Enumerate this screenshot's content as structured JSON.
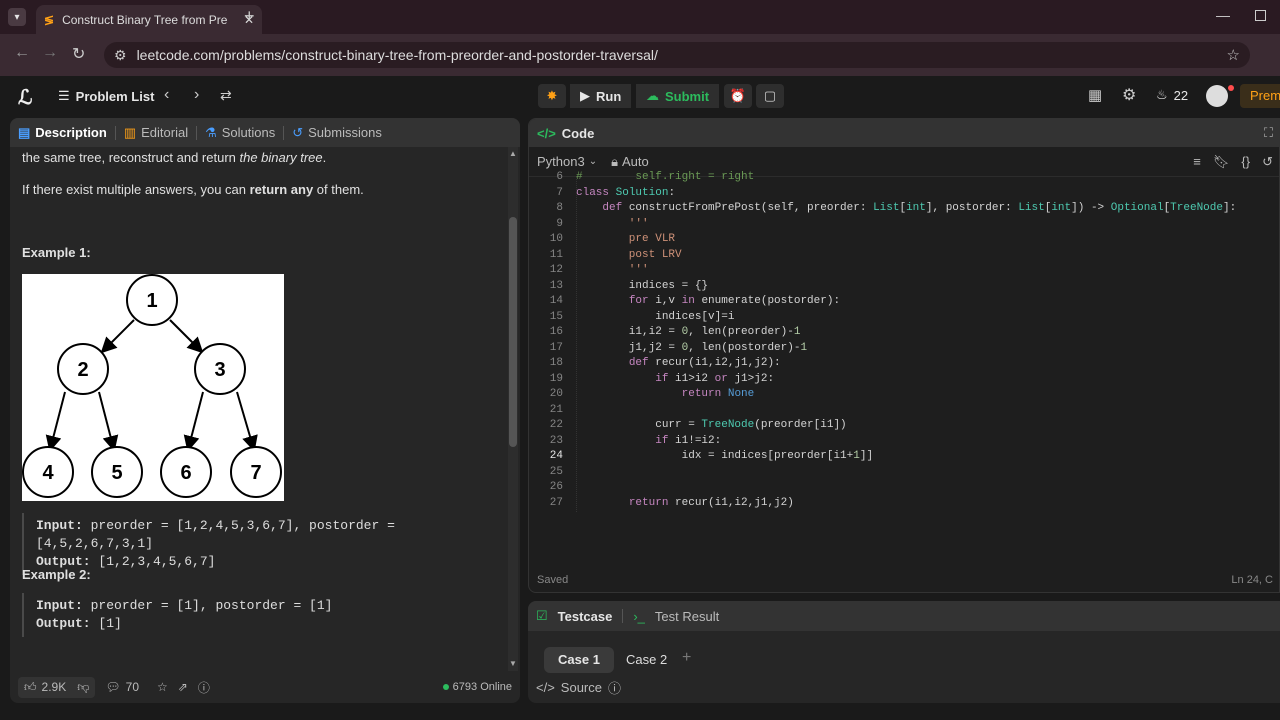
{
  "browser": {
    "tab_title": "Construct Binary Tree from Pre",
    "url": "leetcode.com/problems/construct-binary-tree-from-preorder-and-postorder-traversal/"
  },
  "header": {
    "problem_list": "Problem List",
    "run": "Run",
    "submit": "Submit",
    "streak": "22",
    "premium": "Prem"
  },
  "left_tabs": [
    "Description",
    "Editorial",
    "Solutions",
    "Submissions"
  ],
  "description": {
    "line1_a": "the same tree, reconstruct and return ",
    "line1_b": "the binary tree",
    "line1_c": ".",
    "line2_a": "If there exist multiple answers, you can ",
    "line2_b": "return any",
    "line2_c": " of them.",
    "example1_title": "Example 1:",
    "tree_nodes": [
      "1",
      "2",
      "3",
      "4",
      "5",
      "6",
      "7"
    ],
    "example1_input_label": "Input:",
    "example1_input": "preorder = [1,2,4,5,3,6,7], postorder = [4,5,2,6,7,3,1]",
    "example1_output_label": "Output:",
    "example1_output": "[1,2,3,4,5,6,7]",
    "example2_title": "Example 2:",
    "example2_input_label": "Input:",
    "example2_input": "preorder = [1], postorder = [1]",
    "example2_output_label": "Output:",
    "example2_output": "[1]"
  },
  "left_footer": {
    "likes": "2.9K",
    "comments": "70",
    "online": "6793 Online"
  },
  "code_panel": {
    "title": "Code",
    "language": "Python3",
    "auto": "Auto",
    "status": "Saved",
    "cursor_pos": "Ln 24, C"
  },
  "code_lines": [
    {
      "n": "6",
      "t": "#        self.right = right"
    },
    {
      "n": "7",
      "t": "class Solution:"
    },
    {
      "n": "8",
      "t": "    def constructFromPrePost(self, preorder: List[int], postorder: List[int]) -> Optional[TreeNode]:"
    },
    {
      "n": "9",
      "t": "        '''"
    },
    {
      "n": "10",
      "t": "        pre VLR"
    },
    {
      "n": "11",
      "t": "        post LRV"
    },
    {
      "n": "12",
      "t": "        '''"
    },
    {
      "n": "13",
      "t": "        indices = {}"
    },
    {
      "n": "14",
      "t": "        for i,v in enumerate(postorder):"
    },
    {
      "n": "15",
      "t": "            indices[v]=i"
    },
    {
      "n": "16",
      "t": "        i1,i2 = 0, len(preorder)-1"
    },
    {
      "n": "17",
      "t": "        j1,j2 = 0, len(postorder)-1"
    },
    {
      "n": "18",
      "t": "        def recur(i1,i2,j1,j2):"
    },
    {
      "n": "19",
      "t": "            if i1>i2 or j1>j2:"
    },
    {
      "n": "20",
      "t": "                return None"
    },
    {
      "n": "21",
      "t": ""
    },
    {
      "n": "22",
      "t": "            curr = TreeNode(preorder[i1])"
    },
    {
      "n": "23",
      "t": "            if i1!=i2:"
    },
    {
      "n": "24",
      "t": "                idx = indices[preorder[i1+1]]"
    },
    {
      "n": "25",
      "t": ""
    },
    {
      "n": "26",
      "t": ""
    },
    {
      "n": "27",
      "t": "        return recur(i1,i2,j1,j2)"
    }
  ],
  "test_panel": {
    "testcase": "Testcase",
    "test_result": "Test Result",
    "case1": "Case 1",
    "case2": "Case 2",
    "source": "Source"
  },
  "colors": {
    "accent_orange": "#ffa116",
    "submit_green": "#2cbb5d",
    "online_green": "#2cbb5d"
  }
}
